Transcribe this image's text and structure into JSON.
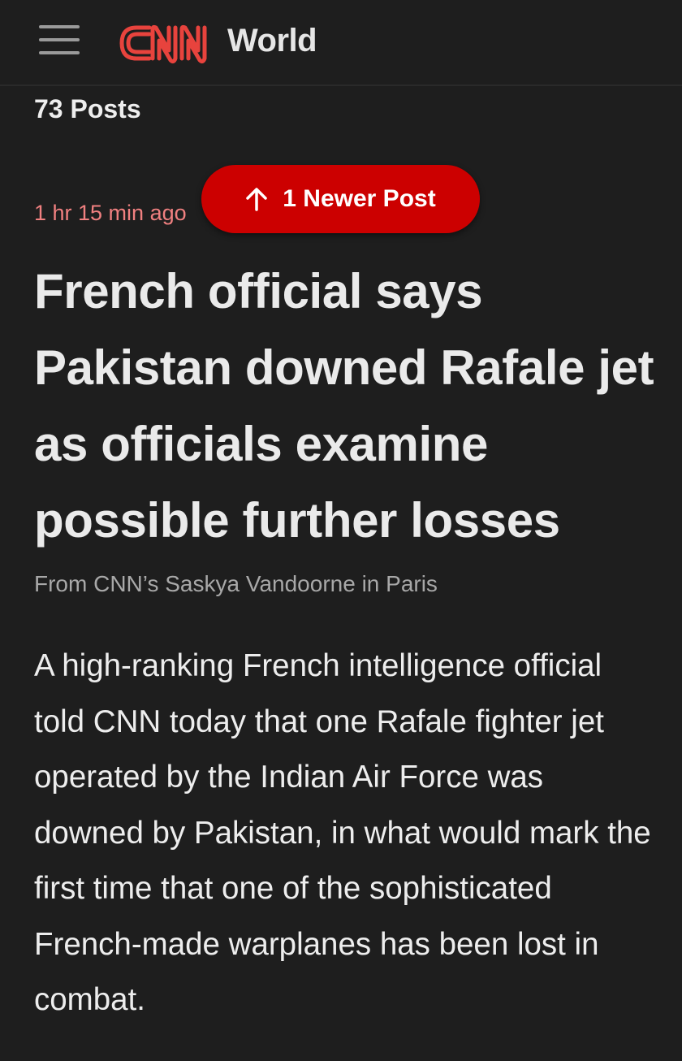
{
  "header": {
    "menu_icon": "hamburger-menu-icon",
    "logo_text": "CNN",
    "section": "World",
    "brand_color": "#cc0000"
  },
  "feed": {
    "posts_count": "73 Posts",
    "newer_button_label": "1 Newer Post",
    "newer_button_icon": "arrow-up-icon"
  },
  "post": {
    "timestamp": "1 hr 15 min ago",
    "headline": "French official says Pakistan downed Rafale jet as officials examine possible further losses",
    "byline": "From CNN’s Saskya Vandoorne in Paris",
    "body": "A high-ranking French intelligence official told CNN today that one Rafale fighter jet operated by the Indian Air Force was downed by Pakistan, in what would mark the first time that one of the sophisticated French-made warplanes has been lost in combat."
  }
}
